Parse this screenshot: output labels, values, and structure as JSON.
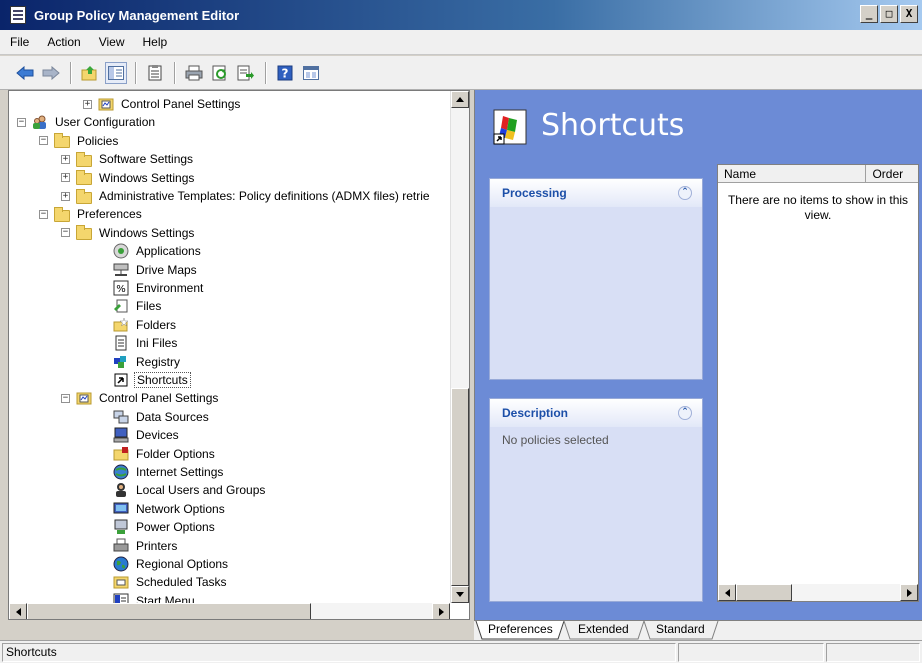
{
  "window": {
    "title": "Group Policy Management Editor",
    "controls": {
      "minimize": "_",
      "maximize": "□",
      "close": "X"
    }
  },
  "menu": {
    "items": [
      {
        "label": "File"
      },
      {
        "label": "Action"
      },
      {
        "label": "View"
      },
      {
        "label": "Help"
      }
    ]
  },
  "toolbar": {
    "buttons": [
      "back-arrow-icon",
      "forward-arrow-icon",
      "up-folder-icon",
      "show-hide-tree-icon",
      "properties-icon",
      "print-icon",
      "refresh-icon",
      "export-list-icon",
      "help-icon",
      "console-icon"
    ]
  },
  "tree": {
    "items": [
      {
        "label": "Control Panel Settings",
        "depth": 3,
        "expander": "+",
        "icon": "control-panel-icon"
      },
      {
        "label": "User Configuration",
        "depth": 0,
        "expander": "-",
        "icon": "user-config-icon"
      },
      {
        "label": "Policies",
        "depth": 1,
        "expander": "-",
        "icon": "folder-icon"
      },
      {
        "label": "Software Settings",
        "depth": 2,
        "expander": "+",
        "icon": "folder-icon"
      },
      {
        "label": "Windows Settings",
        "depth": 2,
        "expander": "+",
        "icon": "folder-icon"
      },
      {
        "label": "Administrative Templates: Policy definitions (ADMX files) retrie",
        "depth": 2,
        "expander": "+",
        "icon": "folder-icon"
      },
      {
        "label": "Preferences",
        "depth": 1,
        "expander": "-",
        "icon": "folder-icon"
      },
      {
        "label": "Windows Settings",
        "depth": 2,
        "expander": "-",
        "icon": "folder-icon"
      },
      {
        "label": "Applications",
        "depth": 3,
        "expander": "",
        "icon": "applications-icon"
      },
      {
        "label": "Drive Maps",
        "depth": 3,
        "expander": "",
        "icon": "drive-maps-icon"
      },
      {
        "label": "Environment",
        "depth": 3,
        "expander": "",
        "icon": "environment-icon"
      },
      {
        "label": "Files",
        "depth": 3,
        "expander": "",
        "icon": "files-icon"
      },
      {
        "label": "Folders",
        "depth": 3,
        "expander": "",
        "icon": "folders-icon"
      },
      {
        "label": "Ini Files",
        "depth": 3,
        "expander": "",
        "icon": "ini-files-icon"
      },
      {
        "label": "Registry",
        "depth": 3,
        "expander": "",
        "icon": "registry-icon"
      },
      {
        "label": "Shortcuts",
        "depth": 3,
        "expander": "",
        "icon": "shortcut-icon",
        "selected": true
      },
      {
        "label": "Control Panel Settings",
        "depth": 2,
        "expander": "-",
        "icon": "control-panel-icon"
      },
      {
        "label": "Data Sources",
        "depth": 3,
        "expander": "",
        "icon": "data-sources-icon"
      },
      {
        "label": "Devices",
        "depth": 3,
        "expander": "",
        "icon": "devices-icon"
      },
      {
        "label": "Folder Options",
        "depth": 3,
        "expander": "",
        "icon": "folder-options-icon"
      },
      {
        "label": "Internet Settings",
        "depth": 3,
        "expander": "",
        "icon": "internet-settings-icon"
      },
      {
        "label": "Local Users and Groups",
        "depth": 3,
        "expander": "",
        "icon": "local-users-icon"
      },
      {
        "label": "Network Options",
        "depth": 3,
        "expander": "",
        "icon": "network-options-icon"
      },
      {
        "label": "Power Options",
        "depth": 3,
        "expander": "",
        "icon": "power-options-icon"
      },
      {
        "label": "Printers",
        "depth": 3,
        "expander": "",
        "icon": "printers-icon"
      },
      {
        "label": "Regional Options",
        "depth": 3,
        "expander": "",
        "icon": "regional-options-icon"
      },
      {
        "label": "Scheduled Tasks",
        "depth": 3,
        "expander": "",
        "icon": "scheduled-tasks-icon"
      },
      {
        "label": "Start Menu",
        "depth": 3,
        "expander": "",
        "icon": "start-menu-icon"
      }
    ]
  },
  "content": {
    "heading": "Shortcuts",
    "processing": {
      "title": "Processing",
      "body": ""
    },
    "description": {
      "title": "Description",
      "body": "No policies selected"
    },
    "list": {
      "columns": [
        "Name",
        "Order"
      ],
      "empty_message": "There are no items to show in this view."
    }
  },
  "tabs": [
    {
      "label": "Preferences",
      "active": true
    },
    {
      "label": "Extended",
      "active": false
    },
    {
      "label": "Standard",
      "active": false
    }
  ],
  "status": {
    "text": "Shortcuts"
  },
  "colors": {
    "content_background": "#6c8bd6",
    "section_title": "#1c4fa8"
  }
}
